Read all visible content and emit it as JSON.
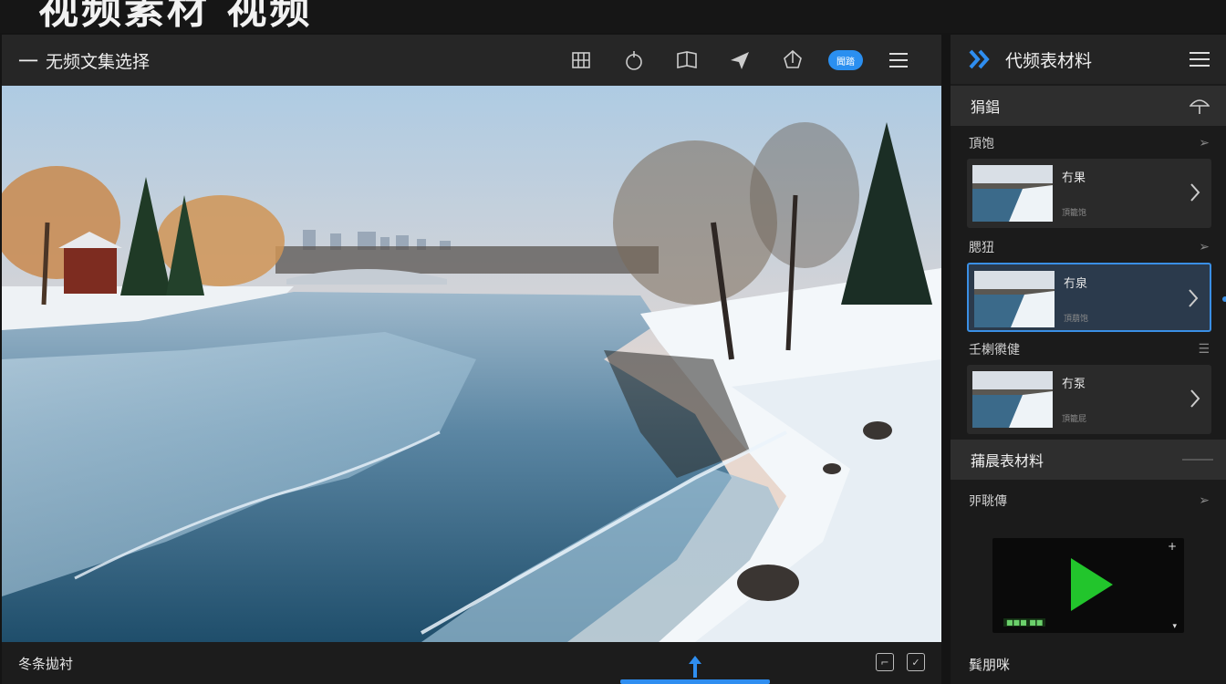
{
  "top_strip": {
    "cut_title": "视频素材 视频"
  },
  "main": {
    "back_dash": "一",
    "title": "无频文集选择",
    "toolbar": {
      "items": [
        {
          "icon": "grid-icon"
        },
        {
          "icon": "apple-icon"
        },
        {
          "icon": "book-icon"
        },
        {
          "icon": "send-icon"
        },
        {
          "icon": "compass-icon"
        },
        {
          "icon": "badge-pill",
          "label": "聞踏"
        },
        {
          "icon": "hamburger-menu-icon"
        }
      ]
    },
    "footer": {
      "location": "冬条拋衬",
      "icons": [
        "crop-icon",
        "check-box-icon"
      ],
      "upload_handle": {
        "icon": "upload-arrow-icon"
      }
    }
  },
  "side": {
    "header": {
      "title": "代频表材料",
      "icon": "double-chevron-icon",
      "menu_icon": "list-menu-icon"
    },
    "group1": {
      "label": "狷錩",
      "icon": "umbrella-icon"
    },
    "sections": [
      {
        "label": "頂饱",
        "icon": "chevron-right-icon",
        "card": {
          "title": "冇果",
          "meta": "頂籠饱",
          "selected": false
        }
      },
      {
        "label": "腮狃",
        "icon": "chevron-right-icon",
        "card": {
          "title": "冇泉",
          "meta": "頂萠饱",
          "selected": true
        }
      },
      {
        "label": "壬楋㣸健",
        "icon": "list-arrow-icon",
        "card": {
          "title": "冇泵",
          "meta": "頂籠屁",
          "selected": false
        }
      }
    ],
    "group2": {
      "label": "蒱晨表材料"
    },
    "video_section": {
      "label": "戼聎傳",
      "icon": "chevron-right-icon"
    },
    "video": {
      "timeline": "■■■ ■■",
      "plus": "+",
      "down": "▾"
    },
    "footer": {
      "label": "髸朋咪"
    }
  },
  "colors": {
    "accent": "#2f8ef0",
    "panel": "#262626",
    "background": "#141414",
    "play": "#22c52c"
  }
}
